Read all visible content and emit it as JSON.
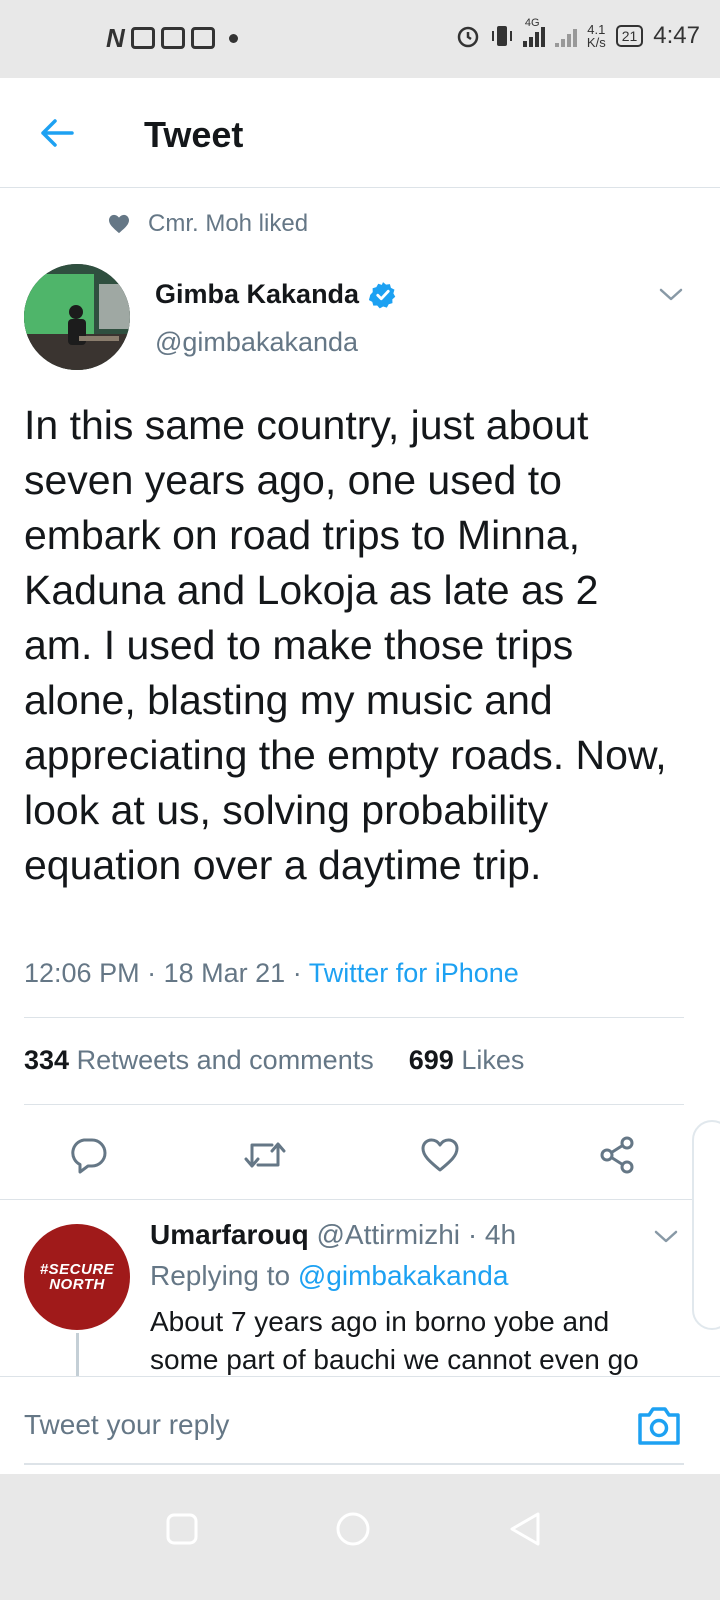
{
  "status_bar": {
    "network_type": "4G",
    "speed_value": "4.1",
    "speed_unit": "K/s",
    "battery": "21",
    "time": "4:47"
  },
  "header": {
    "title": "Tweet"
  },
  "social_context": {
    "text": "Cmr. Moh liked"
  },
  "tweet": {
    "author_name": "Gimba Kakanda",
    "author_handle": "@gimbakakanda",
    "text": "In this same country, just about seven years ago, one used to embark on road trips to Minna, Kaduna and Lokoja as late as 2 am. I used to make those trips alone, blasting my music and appreciating the empty roads. Now, look at us, solving probability equation over a daytime trip.",
    "time": "12:06 PM",
    "date": "18 Mar 21",
    "source": "Twitter for iPhone",
    "retweets_count": "334",
    "retweets_label": "Retweets and comments",
    "likes_count": "699",
    "likes_label": "Likes"
  },
  "reply": {
    "avatar_text_1": "#SECURE",
    "avatar_text_2": "NORTH",
    "author_name": "Umarfarouq",
    "author_handle": "@Attirmizhi",
    "age": "4h",
    "replying_to_label": "Replying to",
    "replying_to_handle": "@gimbakakanda",
    "text": "About 7 years ago in borno yobe and some part of bauchi we cannot even go"
  },
  "composer": {
    "placeholder": "Tweet your reply"
  },
  "colors": {
    "accent": "#1da1f2",
    "muted": "#657786",
    "text": "#14171a"
  }
}
